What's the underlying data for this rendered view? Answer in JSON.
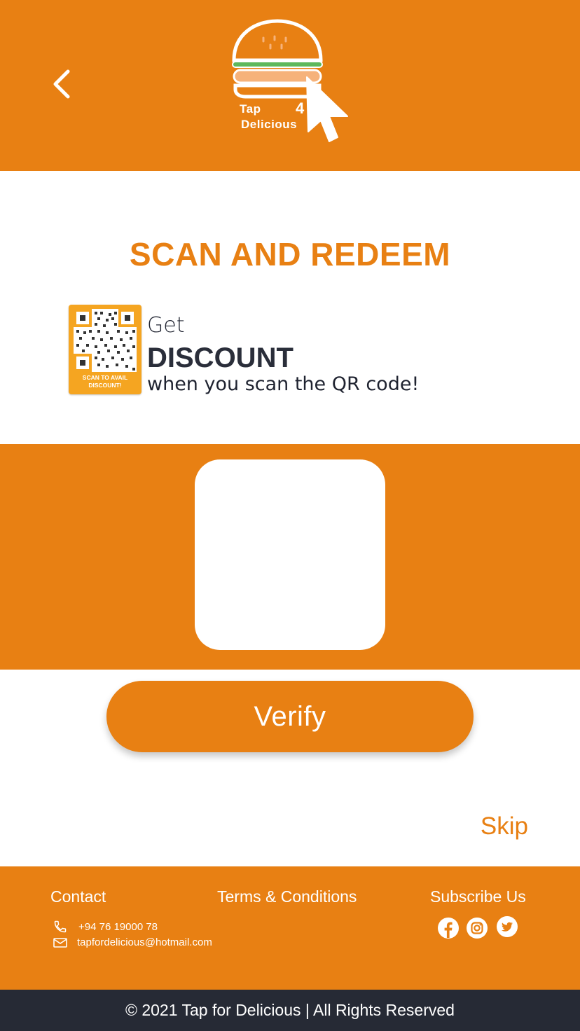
{
  "header": {
    "logo_line1": "Tap",
    "logo_badge": "4",
    "logo_line2": "Delicious"
  },
  "main": {
    "title": "SCAN AND REDEEM",
    "promo": {
      "qr_caption": "SCAN TO AVAIL DISCOUNT!",
      "line1": "Get",
      "line2": "DISCOUNT",
      "line3": "when you scan the QR code!"
    },
    "verify_label": "Verify",
    "skip_label": "Skip"
  },
  "footer": {
    "contact_heading": "Contact",
    "terms_heading": "Terms & Conditions",
    "subscribe_heading": "Subscribe Us",
    "phone": "+94 76 19000 78",
    "email": "tapfordelicious@hotmail.com",
    "copyright": "© 2021 Tap for Delicious | All Rights Reserved"
  },
  "icons": {
    "back": "chevron-left-icon",
    "phone": "phone-icon",
    "email": "mail-icon",
    "socials": [
      "facebook-icon",
      "instagram-icon",
      "twitter-icon"
    ]
  },
  "colors": {
    "brand_orange": "#E88013",
    "footer_dark": "#262A35",
    "qr_badge": "#F5A521",
    "burger_green": "#5DB85C",
    "burger_patty": "#F6B27A"
  }
}
